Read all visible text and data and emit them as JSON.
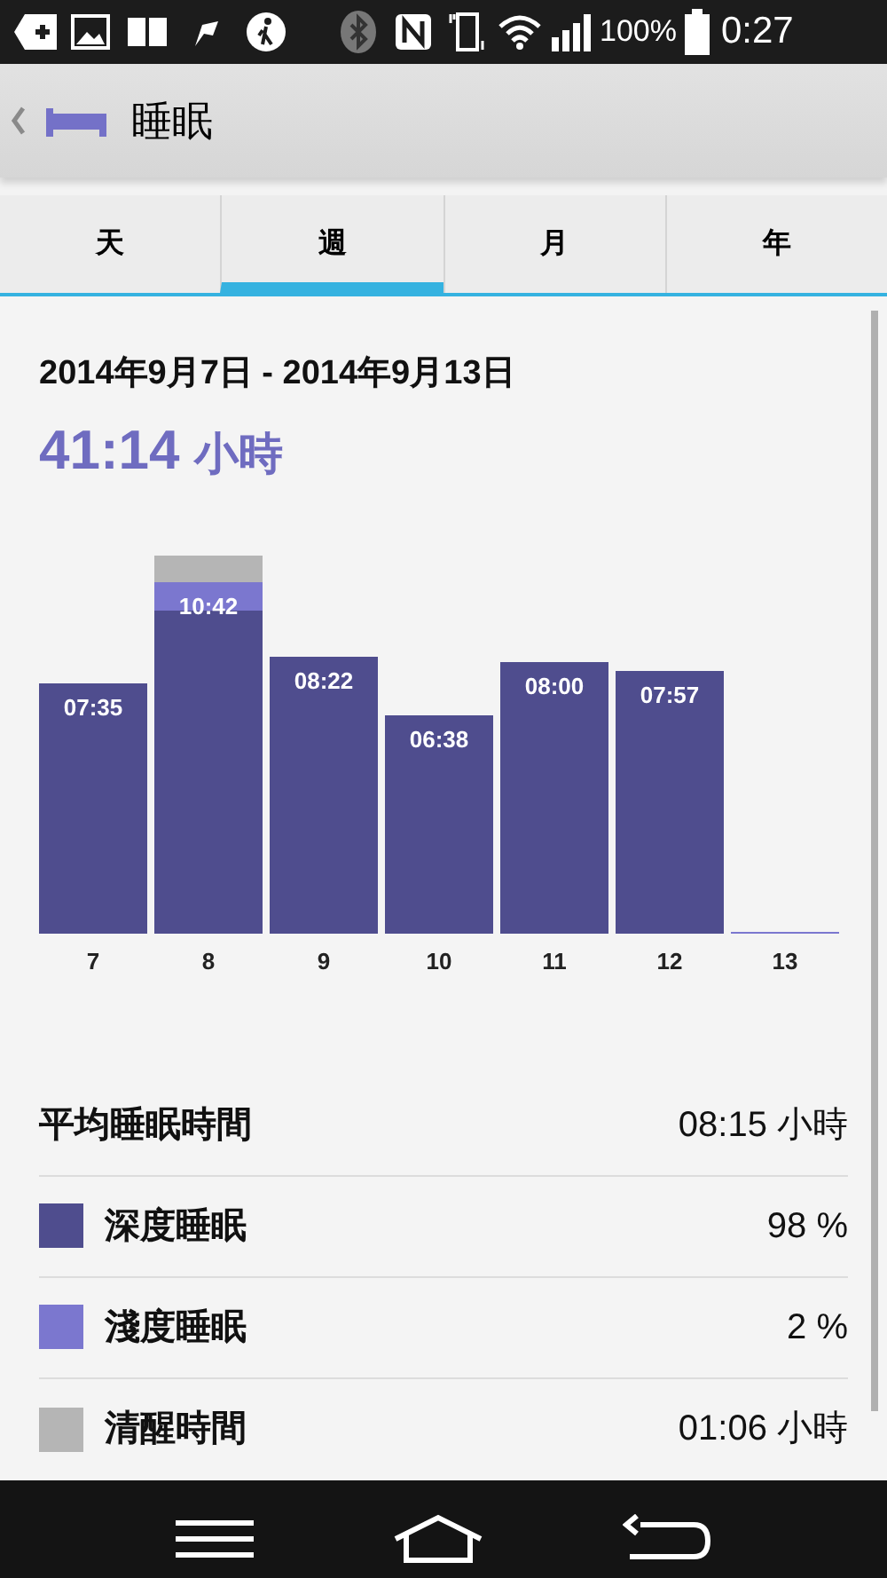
{
  "status_bar": {
    "battery": "100%",
    "time": "0:27"
  },
  "header": {
    "title": "睡眠"
  },
  "tabs": [
    {
      "label": "天",
      "selected": false
    },
    {
      "label": "週",
      "selected": true
    },
    {
      "label": "月",
      "selected": false
    },
    {
      "label": "年",
      "selected": false
    }
  ],
  "date_range": "2014年9月7日 - 2014年9月13日",
  "total": {
    "value": "41:14",
    "unit": "小時"
  },
  "sleep_chart": {
    "bars": [
      {
        "day": "7",
        "label": "07:35",
        "segments": [
          {
            "kind": "deep"
          }
        ]
      },
      {
        "day": "8",
        "label": "10:42",
        "segments": [
          {
            "kind": "deep"
          },
          {
            "kind": "light"
          },
          {
            "kind": "awake"
          }
        ]
      },
      {
        "day": "9",
        "label": "08:22",
        "segments": [
          {
            "kind": "deep"
          }
        ]
      },
      {
        "day": "10",
        "label": "06:38",
        "segments": [
          {
            "kind": "deep"
          }
        ]
      },
      {
        "day": "11",
        "label": "08:00",
        "segments": [
          {
            "kind": "deep"
          }
        ]
      },
      {
        "day": "12",
        "label": "07:57",
        "segments": [
          {
            "kind": "deep"
          }
        ]
      },
      {
        "day": "13"
      }
    ]
  },
  "stats": [
    {
      "kind": "total",
      "label": "平均睡眠時間",
      "value": "08:15 小時"
    },
    {
      "kind": "legend",
      "label": "深度睡眠",
      "value": "98 %",
      "color": "#4f4d8e"
    },
    {
      "kind": "legend",
      "label": "淺度睡眠",
      "value": "2 %",
      "color": "#7b77cf"
    },
    {
      "kind": "legend",
      "label": "清醒時間",
      "value": "01:06 小時",
      "color": "#b5b5b5"
    }
  ]
}
